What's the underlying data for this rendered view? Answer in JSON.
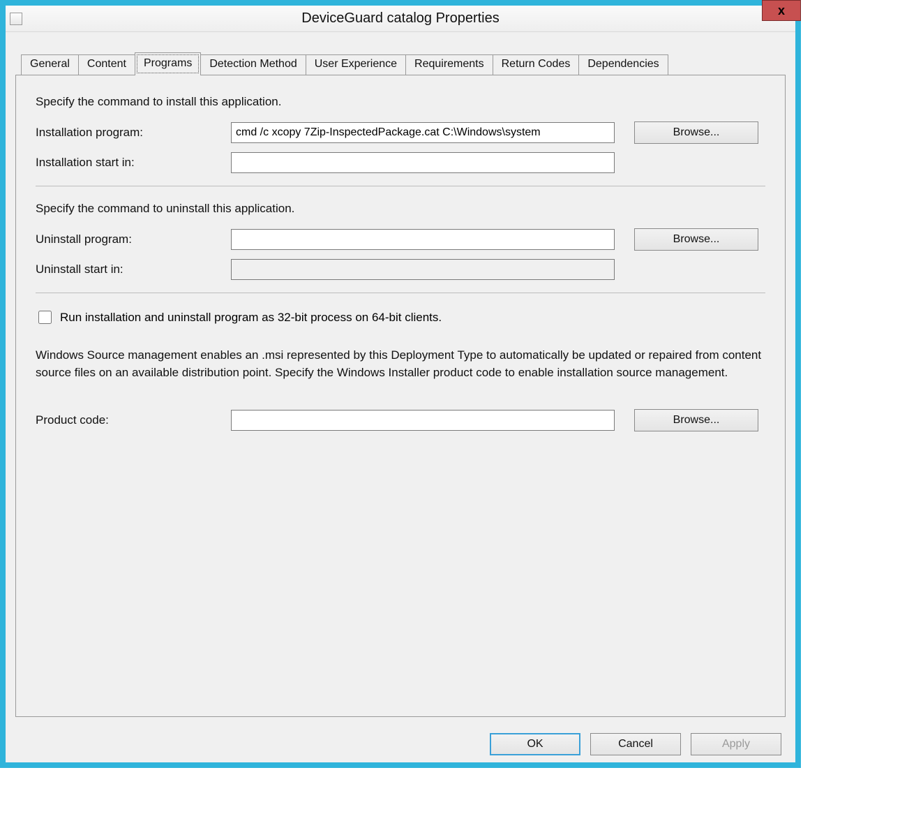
{
  "window": {
    "title": "DeviceGuard catalog Properties",
    "close_label": "x"
  },
  "tabs": [
    {
      "label": "General"
    },
    {
      "label": "Content"
    },
    {
      "label": "Programs",
      "active": true
    },
    {
      "label": "Detection Method"
    },
    {
      "label": "User Experience"
    },
    {
      "label": "Requirements"
    },
    {
      "label": "Return Codes"
    },
    {
      "label": "Dependencies"
    }
  ],
  "programs": {
    "install_section": "Specify the command to install this application.",
    "install_program_label": "Installation program:",
    "install_program_value": "cmd /c xcopy 7Zip-InspectedPackage.cat C:\\Windows\\system",
    "install_startin_label": "Installation start in:",
    "install_startin_value": "",
    "browse_install": "Browse...",
    "uninstall_section": "Specify the command to uninstall this application.",
    "uninstall_program_label": "Uninstall program:",
    "uninstall_program_value": "",
    "uninstall_startin_label": "Uninstall start in:",
    "uninstall_startin_value": "",
    "browse_uninstall": "Browse...",
    "run32_label": "Run installation and uninstall program as 32-bit process on 64-bit clients.",
    "run32_checked": false,
    "msi_desc": "Windows Source management enables an .msi represented by this Deployment Type to automatically be updated or repaired from content source files on an available distribution point. Specify the Windows Installer product code to enable installation source management.",
    "product_code_label": "Product code:",
    "product_code_value": "",
    "browse_product": "Browse..."
  },
  "footer": {
    "ok": "OK",
    "cancel": "Cancel",
    "apply": "Apply"
  }
}
